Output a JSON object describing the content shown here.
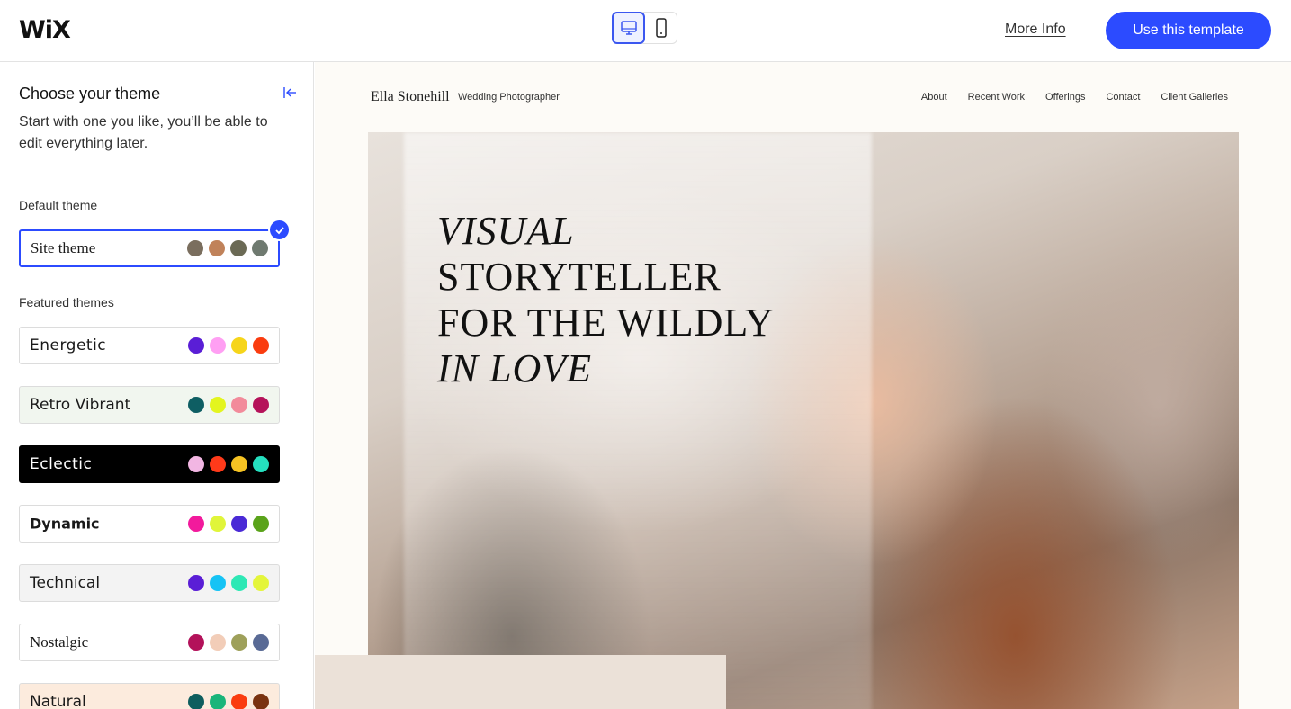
{
  "header": {
    "logo": "WiX",
    "device_toggle": {
      "desktop_icon": "desktop-icon",
      "mobile_icon": "mobile-icon"
    },
    "more_info": "More Info",
    "cta": "Use this template",
    "accent_color": "#2c4bff"
  },
  "sidebar": {
    "title": "Choose your theme",
    "subtitle": "Start with one you like, you’ll be able to edit everything later.",
    "collapse_icon": "collapse-left-icon",
    "default_label": "Default theme",
    "featured_label": "Featured themes",
    "default_theme": {
      "name": "Site theme",
      "selected": true,
      "colors": [
        "#7a6e5e",
        "#c0825a",
        "#6b6a55",
        "#6f7a70"
      ]
    },
    "featured_themes": [
      {
        "name": "Energetic",
        "colors": [
          "#5a1ed6",
          "#ff9ff3",
          "#f6d51a",
          "#fa3c0f"
        ]
      },
      {
        "name": "Retro Vibrant",
        "colors": [
          "#0e5e63",
          "#e3f51f",
          "#f28b9b",
          "#b5125a"
        ]
      },
      {
        "name": "Eclectic",
        "colors": [
          "#f2b6e3",
          "#ff3a1a",
          "#f6c323",
          "#25e0bf"
        ]
      },
      {
        "name": "Dynamic",
        "colors": [
          "#f21a9c",
          "#e0f53a",
          "#4a2ad6",
          "#5aa31a"
        ]
      },
      {
        "name": "Technical",
        "colors": [
          "#5a1ed6",
          "#16c3f5",
          "#2ee8b5",
          "#e4f53a"
        ]
      },
      {
        "name": "Nostalgic",
        "colors": [
          "#b3125a",
          "#f2cdb8",
          "#9ea05a",
          "#596a95"
        ]
      },
      {
        "name": "Natural",
        "colors": [
          "#0e5e5e",
          "#1ab57a",
          "#fa3c0f",
          "#7a3210"
        ]
      }
    ]
  },
  "preview": {
    "site_name": "Ella Stonehill",
    "site_tagline": "Wedding Photographer",
    "nav": [
      "About",
      "Recent Work",
      "Offerings",
      "Contact",
      "Client Galleries"
    ],
    "hero_lines": [
      "VISUAL",
      "STORYTELLER",
      "FOR THE WILDLY",
      "IN LOVE"
    ]
  }
}
